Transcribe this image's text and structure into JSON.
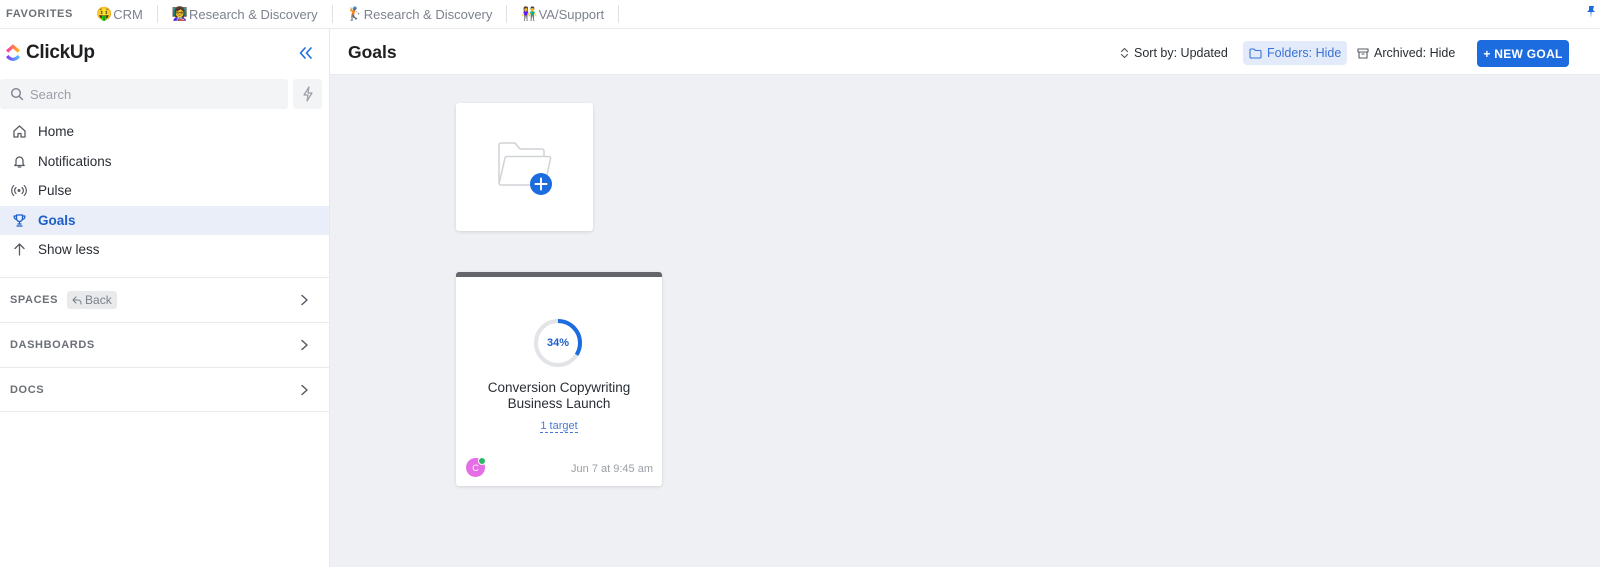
{
  "favorites": {
    "title": "FAVORITES",
    "items": [
      {
        "emoji": "🤑",
        "label": "CRM"
      },
      {
        "emoji": "👩‍🏫",
        "label": "Research & Discovery"
      },
      {
        "emoji": "🏌️",
        "label": "Research & Discovery"
      },
      {
        "emoji": "👫",
        "label": "VA/Support"
      }
    ]
  },
  "sidebar": {
    "logo_text": "ClickUp",
    "search_placeholder": "Search",
    "nav": [
      {
        "label": "Home",
        "icon": "home-icon"
      },
      {
        "label": "Notifications",
        "icon": "bell-icon"
      },
      {
        "label": "Pulse",
        "icon": "broadcast-icon"
      },
      {
        "label": "Goals",
        "icon": "trophy-icon",
        "active": true
      },
      {
        "label": "Show less",
        "icon": "arrow-up-icon"
      }
    ],
    "sections": {
      "spaces": "SPACES",
      "back": "Back",
      "dashboards": "DASHBOARDS",
      "docs": "DOCS"
    }
  },
  "main": {
    "title": "Goals",
    "toolbar": {
      "sort": "Sort by: Updated",
      "folders": "Folders: Hide",
      "archived": "Archived: Hide",
      "new_goal": "+ NEW GOAL"
    },
    "goal": {
      "progress_label": "34%",
      "progress": 0.34,
      "name": "Conversion Copywriting Business Launch",
      "targets": "1 target",
      "avatar_initial": "C",
      "updated": "Jun 7 at 9:45 am"
    }
  },
  "colors": {
    "accent": "#1c6ce0",
    "active_nav_bg": "#e9eef9",
    "main_bg": "#eef0f4"
  }
}
